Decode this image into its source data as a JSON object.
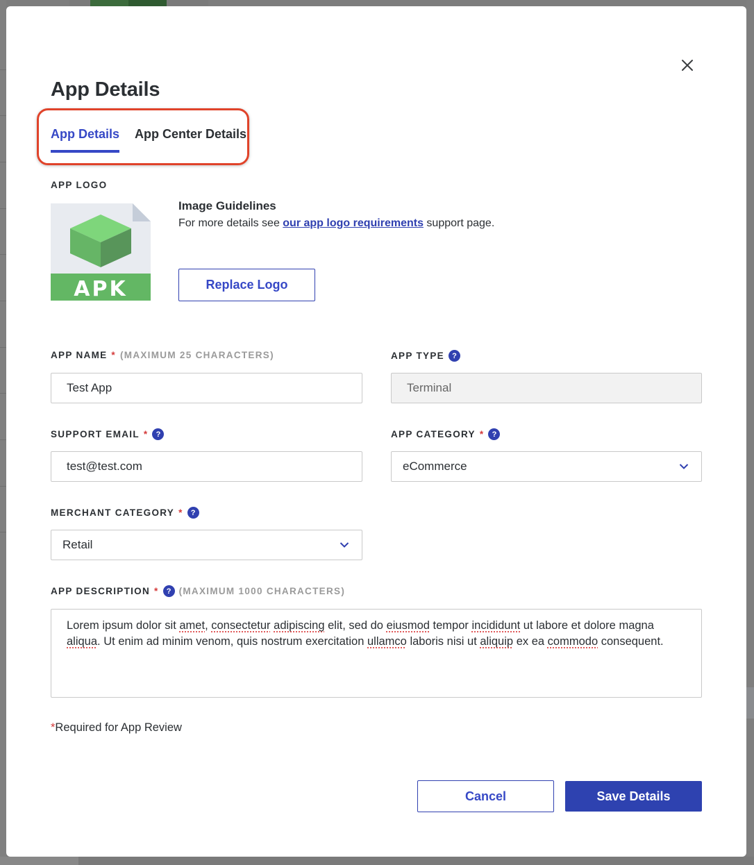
{
  "modal": {
    "title": "App Details",
    "close_icon": "close-icon"
  },
  "tabs": [
    {
      "label": "App Details",
      "active": true
    },
    {
      "label": "App Center Details",
      "active": false
    }
  ],
  "annotation": {
    "highlight_color": "#e0432a"
  },
  "logo": {
    "section_label": "APP LOGO",
    "icon": "apk-file-icon",
    "icon_text": "APK",
    "guidelines_title": "Image Guidelines",
    "guidelines_prefix": "For more details see ",
    "guidelines_link": "our app logo requirements",
    "guidelines_suffix": " support page.",
    "replace_button": "Replace Logo"
  },
  "fields": {
    "app_name": {
      "label": "APP NAME",
      "required": "*",
      "hint": "(MAXIMUM 25 CHARACTERS)",
      "value": "Test App"
    },
    "app_type": {
      "label": "APP TYPE",
      "help": "?",
      "value": "Terminal",
      "disabled": true
    },
    "support_email": {
      "label": "SUPPORT EMAIL",
      "required": "*",
      "help": "?",
      "value": "test@test.com"
    },
    "app_category": {
      "label": "APP CATEGORY",
      "required": "*",
      "help": "?",
      "value": "eCommerce"
    },
    "merchant_category": {
      "label": "MERCHANT CATEGORY",
      "required": "*",
      "help": "?",
      "value": "Retail"
    },
    "app_description": {
      "label": "APP DESCRIPTION",
      "required": "*",
      "help": "?",
      "hint": "(MAXIMUM 1000 CHARACTERS)",
      "value": "Lorem ipsum dolor sit amet, consectetur adipiscing elit, sed do eiusmod tempor incididunt ut labore et dolore magna aliqua. Ut enim ad minim venom, quis nostrum exercitation ullamco laboris nisi ut aliquip ex ea commodo consequent."
    }
  },
  "footer": {
    "required_mark": "*",
    "required_note": "Required for App Review",
    "cancel_label": "Cancel",
    "save_label": "Save Details"
  },
  "colors": {
    "accent": "#3648c6",
    "primary_button": "#2e42b0",
    "required": "#d43a3a",
    "help_icon": "#3040b0"
  }
}
